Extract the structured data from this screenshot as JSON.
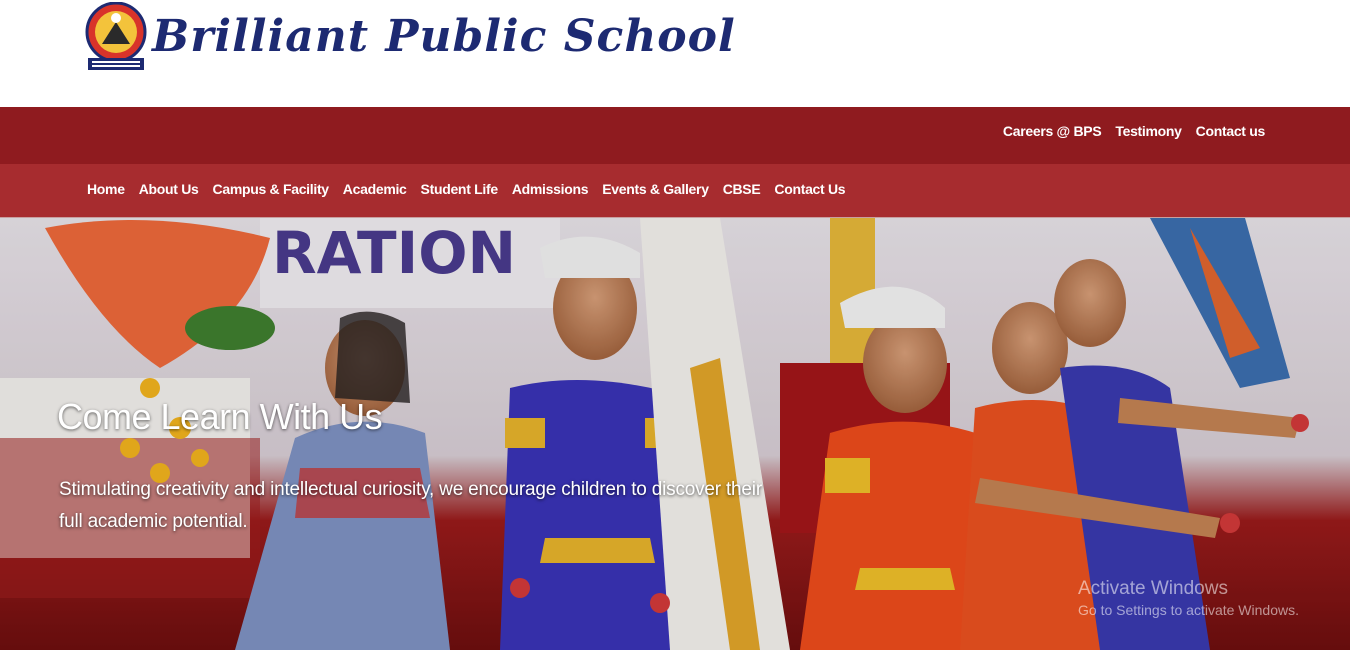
{
  "header": {
    "school_name": "Brilliant Public School"
  },
  "topbar": {
    "links": [
      "Careers @ BPS",
      "Testimony",
      "Contact us"
    ]
  },
  "nav": {
    "items": [
      "Home",
      "About Us",
      "Campus & Facility",
      "Academic",
      "Student Life",
      "Admissions",
      "Events & Gallery",
      "CBSE",
      "Contact Us"
    ]
  },
  "hero": {
    "banner_text": "RATION",
    "title": "Come Learn With Us",
    "text": "Stimulating creativity and intellectual curiosity, we encourage children to discover their full academic potential."
  },
  "watermark": {
    "title": "Activate Windows",
    "subtitle": "Go to Settings to activate Windows."
  },
  "colors": {
    "topbar": "#8f1b1f",
    "navbar": "#a72c2f",
    "school_name": "#1d2a72"
  }
}
